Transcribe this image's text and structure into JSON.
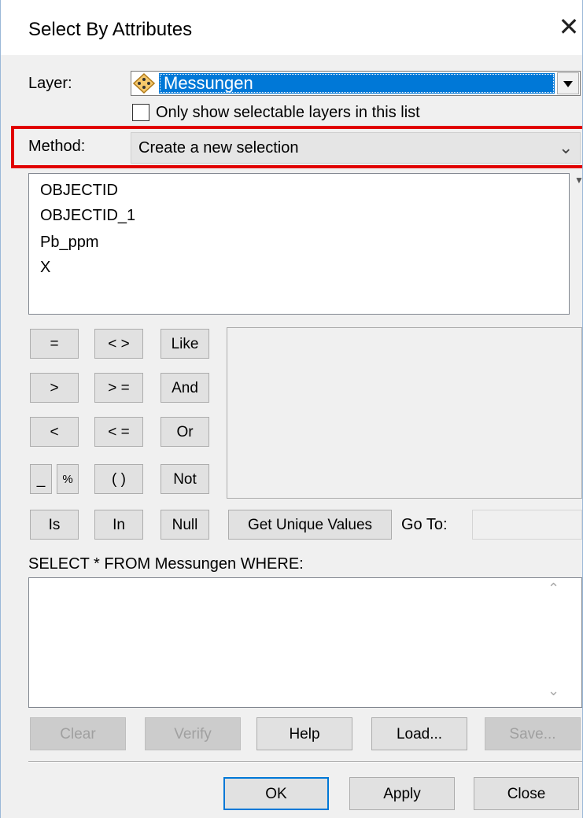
{
  "window": {
    "title": "Select By Attributes",
    "close_glyph": "✕"
  },
  "layer": {
    "label": "Layer:",
    "value": "Messungen",
    "icon": "layer-diamond-icon",
    "only_selectable_label": "Only show selectable layers in this list",
    "only_selectable_checked": false
  },
  "method": {
    "label": "Method:",
    "value": "Create a new selection"
  },
  "fields": [
    "OBJECTID",
    "OBJECTID_1",
    "Pb_ppm",
    "X"
  ],
  "operators": {
    "eq": "=",
    "neq": "< >",
    "like": "Like",
    "gt": ">",
    "gte": "> =",
    "and": "And",
    "lt": "<",
    "lte": "< =",
    "or": "Or",
    "underscore": "_",
    "percent": "%",
    "parens": "( )",
    "not": "Not",
    "is": "Is",
    "in": "In",
    "null": "Null"
  },
  "get_unique_values": "Get Unique Values",
  "goto": {
    "label": "Go To:",
    "value": ""
  },
  "where": {
    "label": "SELECT * FROM Messungen WHERE:",
    "value": ""
  },
  "actions": {
    "clear": "Clear",
    "verify": "Verify",
    "help": "Help",
    "load": "Load...",
    "save": "Save..."
  },
  "footer": {
    "ok": "OK",
    "apply": "Apply",
    "close": "Close"
  },
  "colors": {
    "selection": "#0078d7",
    "highlight_box": "#e10000"
  }
}
